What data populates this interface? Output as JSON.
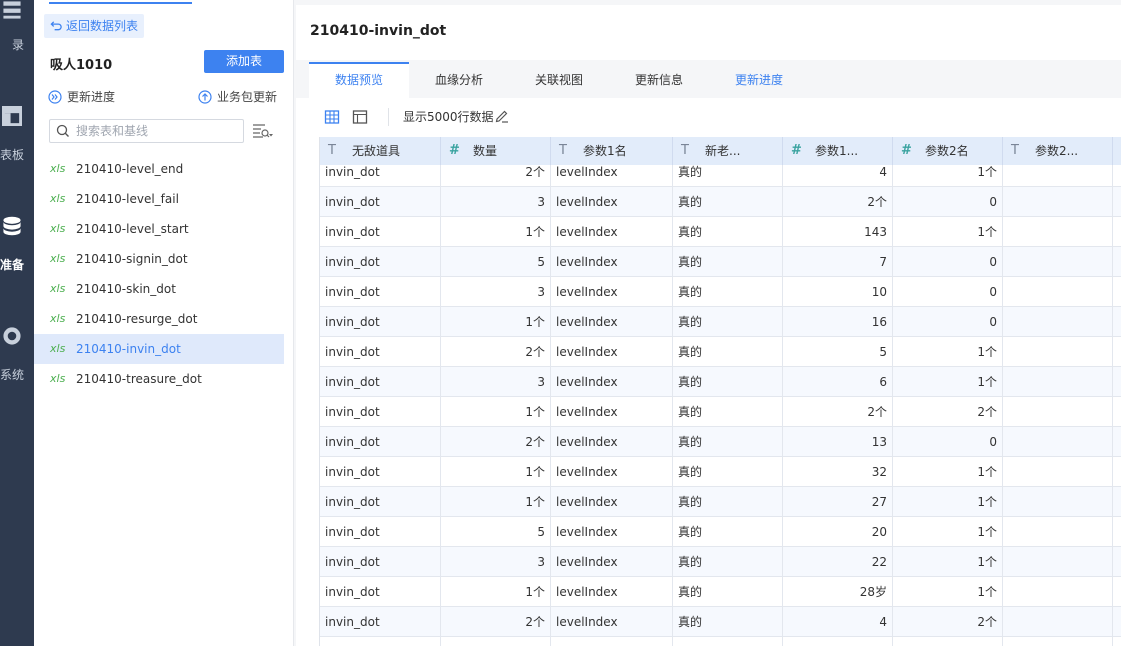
{
  "nav": {
    "items": [
      {
        "label": "录",
        "icon": "list-icon",
        "active": false
      },
      {
        "label": "表板",
        "icon": "dashboard-icon",
        "active": false
      },
      {
        "label": "准备",
        "icon": "database-icon",
        "active": true
      },
      {
        "label": "系统",
        "icon": "gear-icon",
        "active": false
      }
    ]
  },
  "panel": {
    "back_label": "返回数据列表",
    "package_name": "吸人1010",
    "add_table_label": "添加表",
    "update_progress_label": "更新进度",
    "package_update_label": "业务包更新",
    "search_placeholder": "搜索表和基线",
    "tables": [
      "210410-level_end",
      "210410-level_fail",
      "210410-level_start",
      "210410-signin_dot",
      "210410-skin_dot",
      "210410-resurge_dot",
      "210410-invin_dot",
      "210410-treasure_dot"
    ],
    "table_type_badge": "xls",
    "selected_index": 6
  },
  "main": {
    "title": "210410-invin_dot",
    "tabs": [
      {
        "label": "数据预览",
        "active": true,
        "link": false
      },
      {
        "label": "血缘分析",
        "active": false,
        "link": false
      },
      {
        "label": "关联视图",
        "active": false,
        "link": false
      },
      {
        "label": "更新信息",
        "active": false,
        "link": false
      },
      {
        "label": "更新进度",
        "active": false,
        "link": true
      }
    ],
    "rows_label": "显示5000行数据"
  },
  "grid": {
    "columns": [
      {
        "name": "无敌道具",
        "type": "text",
        "align": "left"
      },
      {
        "name": "数量",
        "type": "number",
        "align": "right"
      },
      {
        "name": "参数1名",
        "type": "text",
        "align": "left"
      },
      {
        "name": "新老...",
        "type": "text",
        "align": "left"
      },
      {
        "name": "参数1...",
        "type": "number",
        "align": "right"
      },
      {
        "name": "参数2名",
        "type": "number",
        "align": "right"
      },
      {
        "name": "参数2...",
        "type": "text",
        "align": "left"
      },
      {
        "name": "",
        "type": "text",
        "align": "left"
      }
    ],
    "type_glyphs": {
      "text": "T",
      "number": "#"
    },
    "rows": [
      [
        "invin_dot",
        "2个",
        "levelIndex",
        "真的",
        "4",
        "1个",
        "",
        ""
      ],
      [
        "invin_dot",
        "3",
        "levelIndex",
        "真的",
        "2个",
        "0",
        "",
        ""
      ],
      [
        "invin_dot",
        "1个",
        "levelIndex",
        "真的",
        "143",
        "1个",
        "",
        ""
      ],
      [
        "invin_dot",
        "5",
        "levelIndex",
        "真的",
        "7",
        "0",
        "",
        ""
      ],
      [
        "invin_dot",
        "3",
        "levelIndex",
        "真的",
        "10",
        "0",
        "",
        ""
      ],
      [
        "invin_dot",
        "1个",
        "levelIndex",
        "真的",
        "16",
        "0",
        "",
        ""
      ],
      [
        "invin_dot",
        "2个",
        "levelIndex",
        "真的",
        "5",
        "1个",
        "",
        ""
      ],
      [
        "invin_dot",
        "3",
        "levelIndex",
        "真的",
        "6",
        "1个",
        "",
        ""
      ],
      [
        "invin_dot",
        "1个",
        "levelIndex",
        "真的",
        "2个",
        "2个",
        "",
        ""
      ],
      [
        "invin_dot",
        "2个",
        "levelIndex",
        "真的",
        "13",
        "0",
        "",
        ""
      ],
      [
        "invin_dot",
        "1个",
        "levelIndex",
        "真的",
        "32",
        "1个",
        "",
        ""
      ],
      [
        "invin_dot",
        "1个",
        "levelIndex",
        "真的",
        "27",
        "1个",
        "",
        ""
      ],
      [
        "invin_dot",
        "5",
        "levelIndex",
        "真的",
        "20",
        "1个",
        "",
        ""
      ],
      [
        "invin_dot",
        "3",
        "levelIndex",
        "真的",
        "22",
        "1个",
        "",
        ""
      ],
      [
        "invin_dot",
        "1个",
        "levelIndex",
        "真的",
        "28岁",
        "1个",
        "",
        ""
      ],
      [
        "invin_dot",
        "2个",
        "levelIndex",
        "真的",
        "4",
        "2个",
        "",
        ""
      ],
      [
        "",
        "",
        "",
        "",
        "",
        "",
        "",
        ""
      ]
    ]
  },
  "colors": {
    "accent": "#3d82f0",
    "nav_bg": "#2e3a4f",
    "xls_badge": "#4caf50",
    "header_bg": "#e2ecfa"
  }
}
